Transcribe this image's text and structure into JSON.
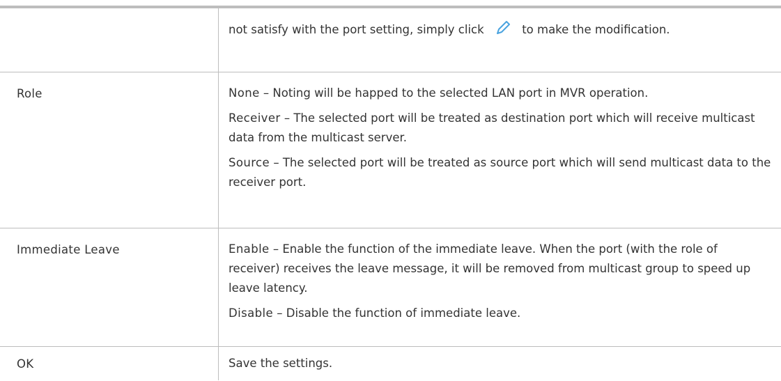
{
  "rows": [
    {
      "term": "",
      "desc_prefix": "not satisfy with the port setting, simply click",
      "desc_icon": "pencil-icon",
      "desc_suffix": "to make the modification."
    },
    {
      "term": "Role",
      "items": [
        {
          "keyword": "None",
          "text": " – Noting will be happed to the selected LAN port in MVR operation."
        },
        {
          "keyword": "Receiver",
          "text": " – The selected port will be treated as destination port which will receive multicast data from the multicast server."
        },
        {
          "keyword": "Source",
          "text": " – The selected port will be treated as source port which will send multicast data to the receiver port."
        }
      ]
    },
    {
      "term": "Immediate Leave",
      "items": [
        {
          "keyword": "Enable",
          "text": " – Enable the function of the immediate leave. When the port (with the role of receiver) receives the leave message, it will be removed from multicast group to speed up leave latency."
        },
        {
          "keyword": "Disable",
          "text": " – Disable the function of immediate leave."
        }
      ]
    },
    {
      "term": "OK",
      "desc": "Save the settings."
    }
  ],
  "colors": {
    "rule": "#bdbdbd",
    "text": "#333333",
    "icon": "#4aa3df"
  }
}
